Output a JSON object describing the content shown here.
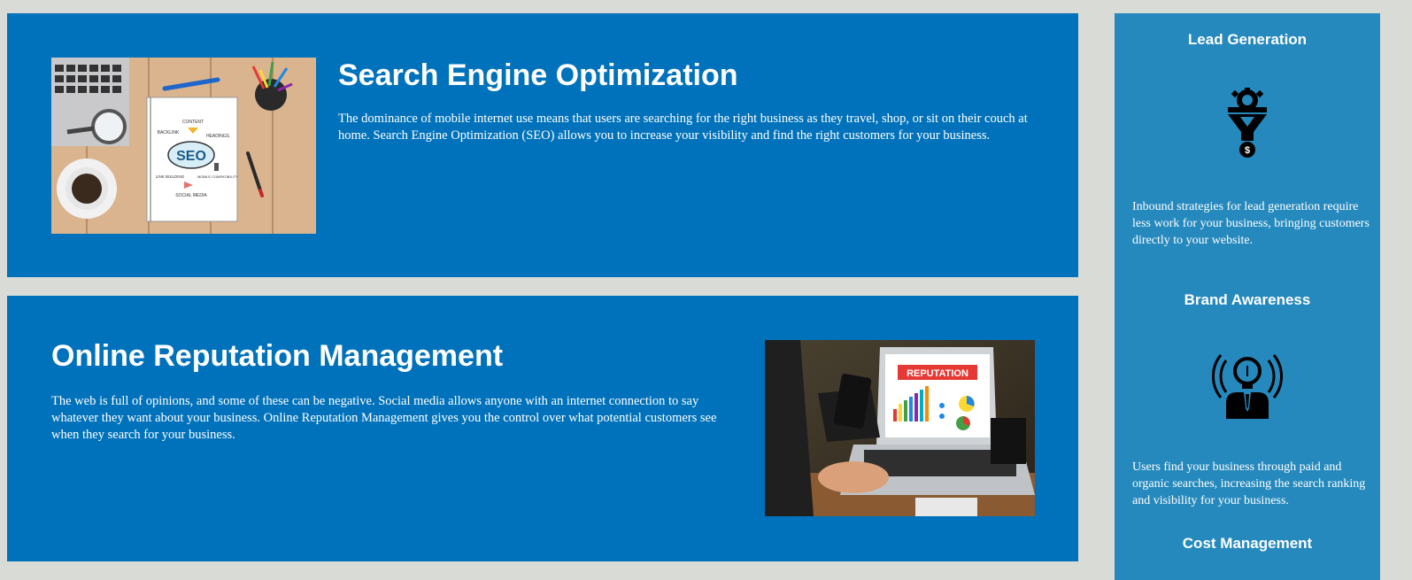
{
  "services": {
    "seo": {
      "title": "Search Engine Optimization",
      "body": "The dominance of mobile internet use means that users are searching for the right business as they travel, shop, or sit on their couch at home. Search Engine Optimization (SEO) allows you to increase your visibility and find the right customers for your business.",
      "image": {
        "notebook_center": "SEO",
        "tags": [
          "CONTENT",
          "BACKLINK",
          "HEADINGS",
          "LINK BUILDING",
          "MOBILE COMPATIBILITY",
          "SOCIAL MEDIA"
        ]
      }
    },
    "orm": {
      "title": "Online Reputation Management",
      "body": "The web is full of opinions, and some of these can be negative. Social media allows anyone with an internet connection to say whatever they want about your business. Online Reputation Management gives you the control over what potential customers see when they search for your business.",
      "image": {
        "screen_banner": "REPUTATION"
      }
    }
  },
  "benefits": [
    {
      "title": "Lead Generation",
      "icon": "funnel-gear-dollar-icon",
      "body": "Inbound strategies for lead generation require less work for your business, bringing customers directly to your website."
    },
    {
      "title": "Brand Awareness",
      "icon": "lightbulb-person-icon",
      "body": "Users find your business through paid and organic searches, increasing the search ranking and visibility for your business."
    },
    {
      "title": "Cost Management",
      "icon": "",
      "body": ""
    }
  ],
  "colors": {
    "page_background": "#d9dcd6",
    "card_background": "#0072bb",
    "sidebar_background": "#2589bd",
    "text": "#ffffff"
  }
}
